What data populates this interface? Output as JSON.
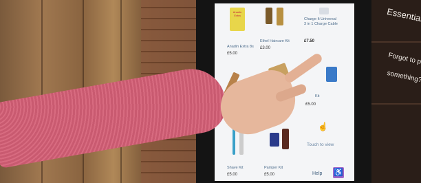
{
  "kiosk": {
    "products": [
      {
        "name": "Anadin Extra 8s",
        "price": "£5.00"
      },
      {
        "name": "Ethel Haircare Kit",
        "price": "£3.00"
      },
      {
        "name": "Charge It Universal 3 in 1 Charge Cable",
        "price": "£7.50"
      },
      {
        "name": "",
        "price": ""
      },
      {
        "name": "",
        "price": ""
      },
      {
        "name": "Kit",
        "price": "£5.00"
      },
      {
        "name": "Shave Kit",
        "price": "£5.00"
      },
      {
        "name": "Pamper Kit",
        "price": "£5.00"
      }
    ],
    "touch_label": "Touch to view",
    "help_label": "Help",
    "accessibility_icon": "wheelchair-icon",
    "brand_label": "Anadin Extra"
  },
  "sign": {
    "line1": "Essentials",
    "line2": "Forgot to pack",
    "line3": "something?"
  },
  "colors": {
    "accessibility": "#a066c8",
    "screen": "#f4f5f7"
  }
}
